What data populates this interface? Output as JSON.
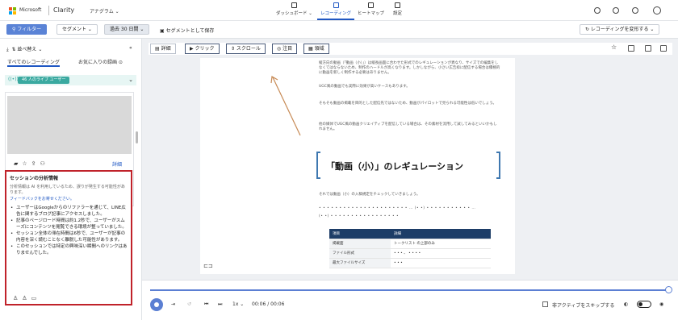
{
  "header": {
    "brand": "Microsoft",
    "product": "Clarity",
    "project": "アナグラム ⌄",
    "nav": [
      {
        "label": "ダッシュボード ⌄"
      },
      {
        "label": "レコーディング"
      },
      {
        "label": "ヒートマップ"
      },
      {
        "label": "設定"
      }
    ]
  },
  "filterbar": {
    "filter_label": "⚲ フィルター",
    "segment_label": "セグメント ⌄",
    "date_label": "過去 30 日間 ⌄",
    "save_segment_label": "セグメントとして保存",
    "share_label": "↻ レコーディングを変形する ⌄"
  },
  "left_panel": {
    "sort_label": "並べ替え ⌄",
    "collapse": "«",
    "tabs": [
      {
        "label": "すべてのレコーディング"
      },
      {
        "label": "お気に入りの録画 ⊙"
      }
    ],
    "live_users": "46 人のライブ ユーザー",
    "card_detail": "詳細",
    "analysis": {
      "title": "セッションの分析情報",
      "note": "分析情報は AI を利用しているため、誤りが発生する可能性があります。",
      "feedback_link": "フィードバックをお寄せください。",
      "bullets": [
        "ユーザーはGoogleからのリファラーを通じて、LINE広告に関するブログ記事にアクセスしました。",
        "記事のページロード時間は約1.2秒で、ユーザーがスムーズにコンテンツを閲覧できる環境が整っていました。",
        "セッション全体の滞在時間は6秒で、ユーザーが記事の内容を深く読むことなく離脱した可能性があります。",
        "このセッションでは特定の興味深い瞬間へのリンクはありませんでした。"
      ]
    }
  },
  "toolbar": {
    "detail": "詳細",
    "click": "▶ クリック",
    "scroll": "⇕ スクロール",
    "attention": "注目",
    "area": "領域"
  },
  "doc": {
    "para1": "縦方向の動画（「動画（小）」）は縦長画面に合わせた形式でのレギュレーションが異なり、サイズでの編集をしなくてはならないため、制作のハードルが高くなります。しかしながら、小さい広告枠に配信する場合は積極的に動画を新しく制作する必要はありません。",
    "para2": "UGC風の動画でも実際に効果が高いケースもあります。",
    "para3": "そもそも動画の掲載を目的とした配信先ではないため、動画がパイロットで見られる可能性は低いでしょう。",
    "para4": "他の媒体でUGC風の動画クリエイティブを配信している場合は、その素材を流用して試してみるといいかもしれません。",
    "heading": "「動画（小）」のレギュレーション",
    "para5": "それでは動画（小）の入稿規定をチェックしていきましょう。",
    "para6": "• • • • • • • • • • • • • • • • • • • • • • … (• •) • • • • • • • • • • • …",
    "para7": "(• •) • • • • • • • • • • • • • • • • •",
    "table_header": [
      "項目",
      "詳細"
    ],
    "table_rows": [
      [
        "掲載面",
        "トークリスト の上部のみ"
      ],
      [
        "ファイル形式",
        "• • • 、 • • • •"
      ],
      [
        "最大ファイルサイズ",
        "• • •"
      ]
    ]
  },
  "player": {
    "speed": "1x ⌄",
    "time": "00:06 / 00:06",
    "skip_label": "非アクティブをスキップする",
    "progress": 1.0
  }
}
